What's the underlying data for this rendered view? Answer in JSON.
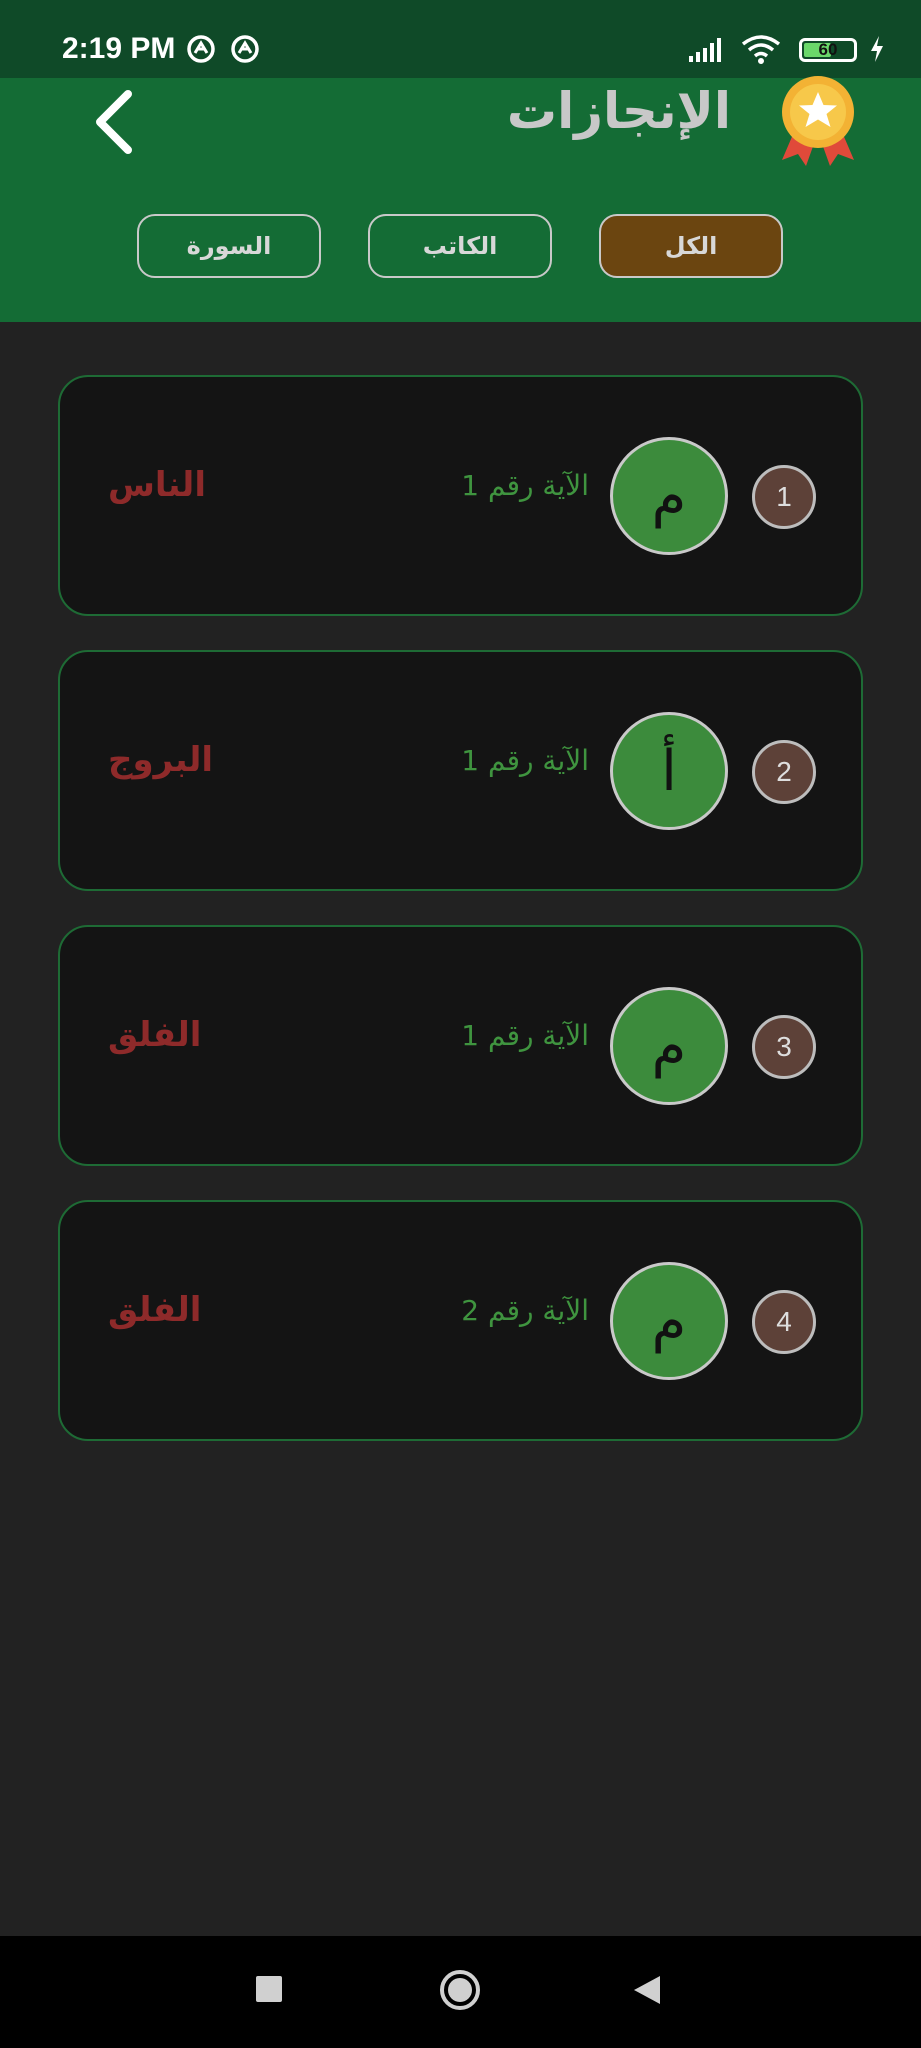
{
  "status_bar": {
    "time": "2:19 PM",
    "battery": "60",
    "battery_level": 0.6
  },
  "header": {
    "title": "الإنجازات"
  },
  "tabs": [
    {
      "label": "الكل",
      "active": true
    },
    {
      "label": "الكاتب",
      "active": false
    },
    {
      "label": "السورة",
      "active": false
    }
  ],
  "achievements": [
    {
      "number": "1",
      "letter": "م",
      "ayah": "الآية رقم 1",
      "surah": "الناس"
    },
    {
      "number": "2",
      "letter": "أ",
      "ayah": "الآية رقم 1",
      "surah": "البروج"
    },
    {
      "number": "3",
      "letter": "م",
      "ayah": "الآية رقم 1",
      "surah": "الفلق"
    },
    {
      "number": "4",
      "letter": "م",
      "ayah": "الآية رقم 2",
      "surah": "الفلق"
    }
  ],
  "colors": {
    "header_bg": "#146c35",
    "status_bg": "#0f4a28",
    "active_tab": "#6b4510",
    "letter_badge": "#3c8b3c",
    "surah_text": "#8e2a2a",
    "ayah_text": "#3f943f"
  },
  "icons": {
    "back": "chevron-left-icon",
    "medal": "medal-star-icon",
    "nav_recents": "square-icon",
    "nav_home": "circle-icon",
    "nav_back": "triangle-back-icon"
  }
}
